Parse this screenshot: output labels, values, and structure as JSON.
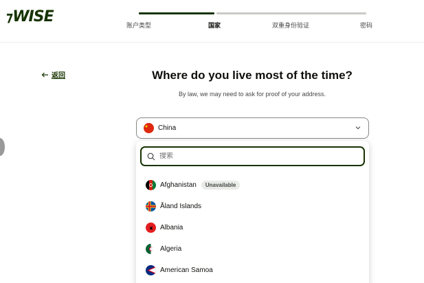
{
  "brand": {
    "logo_text": "WISE",
    "logo_mark": "⁊",
    "color": "#163300"
  },
  "steps": [
    {
      "label": "账户类型",
      "state": "done"
    },
    {
      "label": "国家",
      "state": "current"
    },
    {
      "label": "双重身份验证",
      "state": "todo"
    },
    {
      "label": "密码",
      "state": "todo"
    }
  ],
  "back": {
    "label": "返回",
    "icon": "arrow-left-icon"
  },
  "main": {
    "title": "Where do you live most of the time?",
    "subtitle": "By law, we may need to ask for proof of your address."
  },
  "country_select": {
    "selected": "China",
    "selected_flag": "china-flag",
    "icon": "chevron-down-icon"
  },
  "dropdown": {
    "search_placeholder": "搜索",
    "options": [
      {
        "name": "Afghanistan",
        "badge": "Unavailable",
        "flag": "afghanistan-flag"
      },
      {
        "name": "Åland Islands",
        "flag": "aland-flag"
      },
      {
        "name": "Albania",
        "flag": "albania-flag"
      },
      {
        "name": "Algeria",
        "flag": "algeria-flag"
      },
      {
        "name": "American Samoa",
        "flag": "american-samoa-flag"
      }
    ]
  },
  "colors": {
    "accent": "#163300",
    "border": "#868685",
    "badge_bg": "#e8ebe6"
  }
}
